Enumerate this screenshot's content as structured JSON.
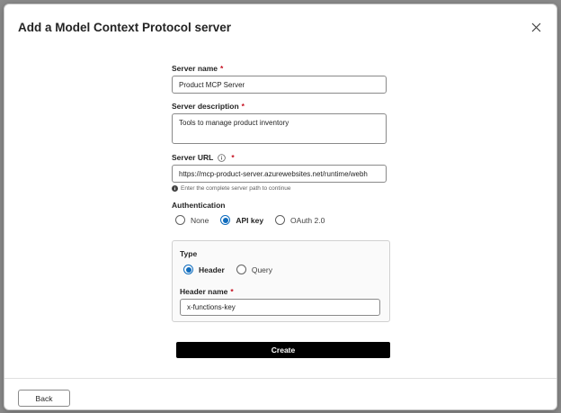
{
  "dialog": {
    "title": "Add a Model Context Protocol server",
    "close_icon": "close-icon"
  },
  "form": {
    "server_name": {
      "label": "Server name",
      "required": "*",
      "value": "Product MCP Server"
    },
    "server_description": {
      "label": "Server description",
      "required": "*",
      "value": "Tools to manage product inventory"
    },
    "server_url": {
      "label": "Server URL",
      "required": "*",
      "info_icon": "info-icon",
      "value": "https://mcp-product-server.azurewebsites.net/runtime/webh",
      "hint_icon": "info-filled-icon",
      "hint": "Enter the complete server path to continue"
    },
    "authentication": {
      "label": "Authentication",
      "options": [
        "None",
        "API key",
        "OAuth 2.0"
      ],
      "selected": "API key"
    },
    "type": {
      "label": "Type",
      "options": [
        "Header",
        "Query"
      ],
      "selected": "Header"
    },
    "header_name": {
      "label": "Header name",
      "required": "*",
      "value": "x-functions-key"
    },
    "create_label": "Create"
  },
  "footer": {
    "back_label": "Back"
  },
  "colors": {
    "accent": "#0f6cbd",
    "required": "#c50f1f",
    "primary_button": "#000000"
  }
}
